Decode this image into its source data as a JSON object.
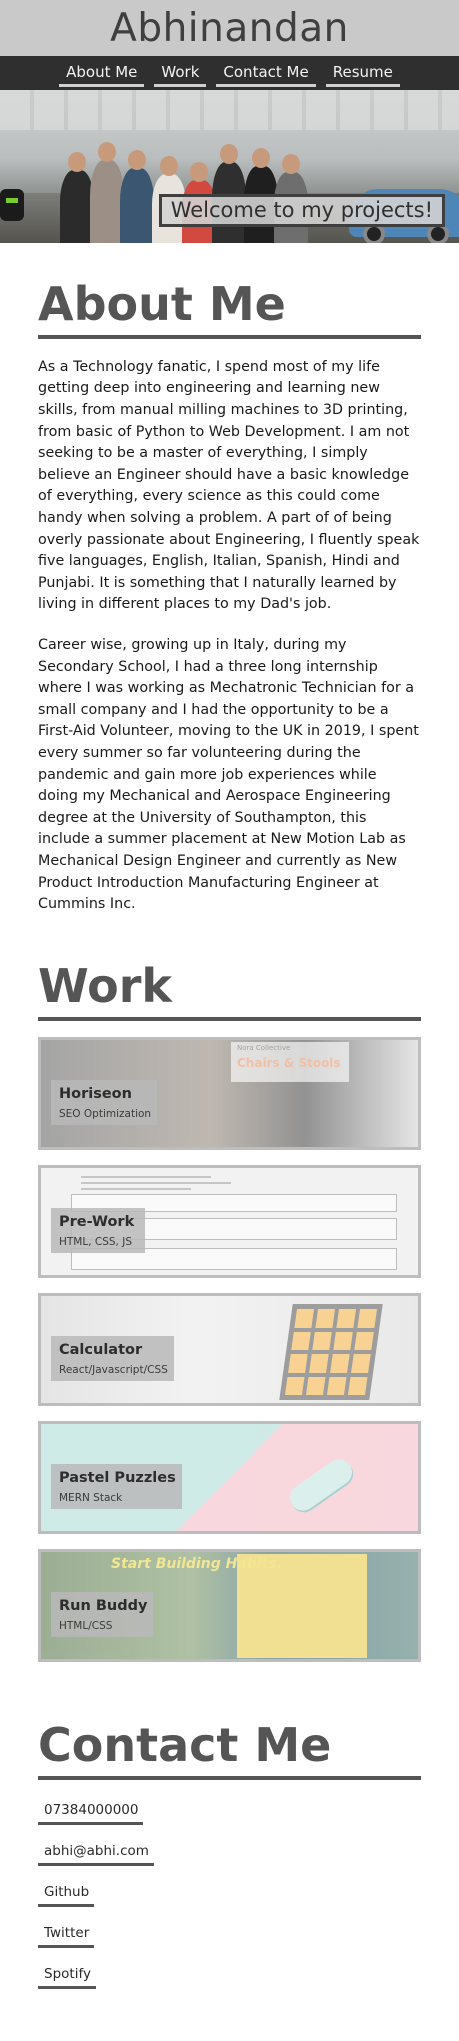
{
  "header": {
    "title": "Abhinandan"
  },
  "nav": {
    "items": [
      "About Me",
      "Work",
      "Contact Me",
      "Resume"
    ]
  },
  "hero": {
    "caption": "Welcome to my projects!"
  },
  "about": {
    "title": "About Me",
    "paragraphs": [
      "As a Technology fanatic, I spend most of my life getting deep into engineering and learning new skills, from manual milling machines to 3D printing, from basic of Python to Web Development. I am not seeking to be a master of everything, I simply believe an Engineer should have a basic knowledge of everything, every science as this could come handy when solving a problem. A part of of being overly passionate about Engineering, I fluently speak five languages, English, Italian, Spanish, Hindi and Punjabi. It is something that I naturally learned by living in different places to my Dad's job.",
      "Career wise, growing up in Italy, during my Secondary School, I had a three long internship where I was working as Mechatronic Technician for a small company and I had the opportunity to be a First-Aid Volunteer, moving to the UK in 2019, I spent every summer so far volunteering during the pandemic and gain more job experiences while doing my Mechanical and Aerospace Engineering degree at the University of Southampton, this include a summer placement at New Motion Lab as Mechanical Design Engineer and currently as New Product Introduction Manufacturing Engineer at Cummins Inc."
    ]
  },
  "work": {
    "title": "Work",
    "projects": [
      {
        "name": "Horiseon",
        "tech": "SEO Optimization",
        "image_text_1": "Nora Collective",
        "image_text_2": "Chairs & Stools"
      },
      {
        "name": "Pre-Work",
        "tech": "HTML, CSS, JS"
      },
      {
        "name": "Calculator",
        "tech": "React/Javascript/CSS"
      },
      {
        "name": "Pastel Puzzles",
        "tech": "MERN Stack"
      },
      {
        "name": "Run Buddy",
        "tech": "HTML/CSS",
        "image_text_1": "Start Building Habits."
      }
    ]
  },
  "contact": {
    "title": "Contact Me",
    "items": [
      "07384000000",
      "abhi@abhi.com",
      "Github",
      "Twitter",
      "Spotify"
    ]
  }
}
